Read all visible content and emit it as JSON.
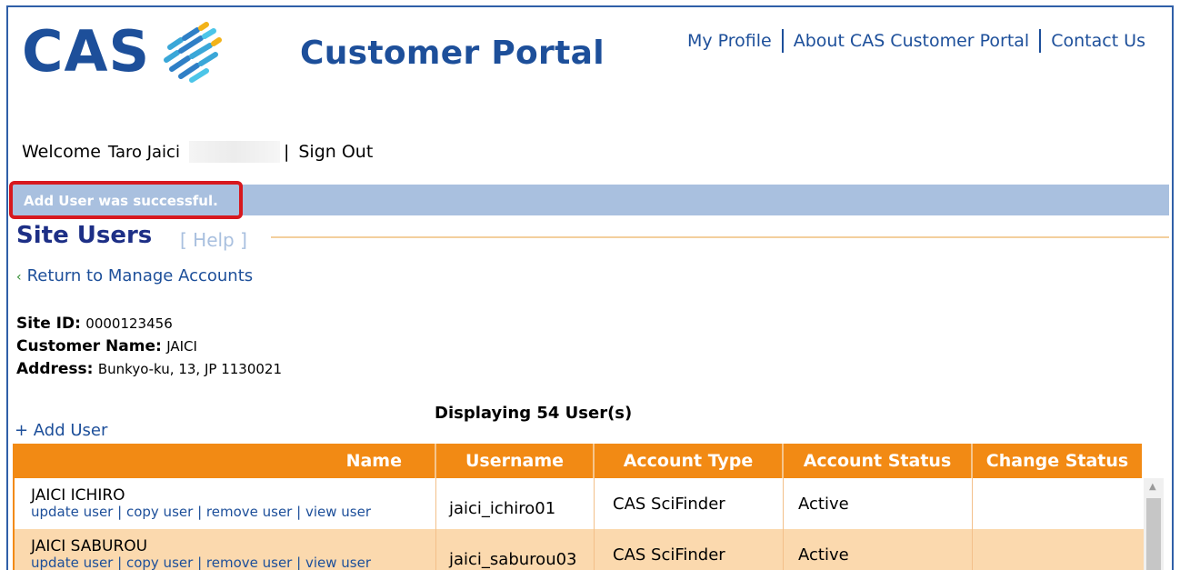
{
  "header": {
    "logo_text": "CAS",
    "portal_title": "Customer Portal",
    "links": [
      "My Profile",
      "About CAS Customer Portal",
      "Contact Us"
    ],
    "brand_color": "#1d4f9a"
  },
  "session": {
    "welcome_label": "Welcome",
    "user_name": "Taro Jaici",
    "separator": "|",
    "sign_out": "Sign Out"
  },
  "banner": {
    "message": "Add User was successful.",
    "color": "#a9c0df",
    "highlight_color": "#d7181e"
  },
  "section": {
    "title": "Site Users",
    "help": "[ Help ]",
    "return_chevron": "‹",
    "return_link": "Return to Manage Accounts"
  },
  "site_info": {
    "site_id_label": "Site ID:",
    "site_id": "0000123456",
    "customer_name_label": "Customer Name:",
    "customer_name": "JAICI",
    "address_label": "Address:",
    "address": "Bunkyo-ku, 13, JP 1130021"
  },
  "users": {
    "displaying": "Displaying 54 User(s)",
    "add_user": "+ Add User",
    "columns": [
      "Name",
      "Username",
      "Account Type",
      "Account Status",
      "Change Status"
    ],
    "actions": [
      "update user",
      "copy user",
      "remove user",
      "view user"
    ],
    "rows": [
      {
        "name": "JAICI ICHIRO",
        "username": "jaici_ichiro01",
        "account_type": "CAS SciFinder",
        "account_status": "Active",
        "change_status": ""
      },
      {
        "name": "JAICI SABUROU",
        "username": "jaici_saburou03",
        "account_type": "CAS SciFinder",
        "account_status": "Active",
        "change_status": ""
      }
    ],
    "header_color": "#f28a14",
    "alt_row_color": "#fbd9ae"
  }
}
